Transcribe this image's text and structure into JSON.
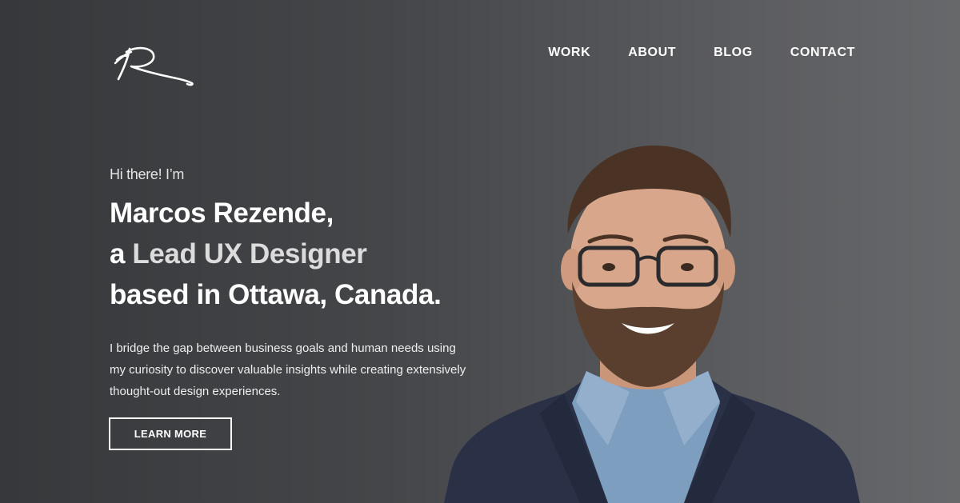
{
  "brand": {
    "logo_icon": "signature-logo"
  },
  "nav": {
    "items": [
      {
        "label": "WORK"
      },
      {
        "label": "ABOUT"
      },
      {
        "label": "BLOG"
      },
      {
        "label": "CONTACT"
      }
    ]
  },
  "hero": {
    "greeting": "Hi there! I’m",
    "name_line": "Marcos Rezende,",
    "role_prefix": "a ",
    "role": "Lead UX Designer",
    "location_line": "based in Ottawa, Canada.",
    "description": "I bridge the gap between business goals and human needs using my curiosity to discover valuable insights while creating extensively thought-out design experiences.",
    "cta_label": "LEARN MORE"
  },
  "colors": {
    "background_dark": "#36383b",
    "background_light": "#67686b",
    "text_primary": "#ffffff",
    "role_highlight": "#dcdcdd"
  }
}
